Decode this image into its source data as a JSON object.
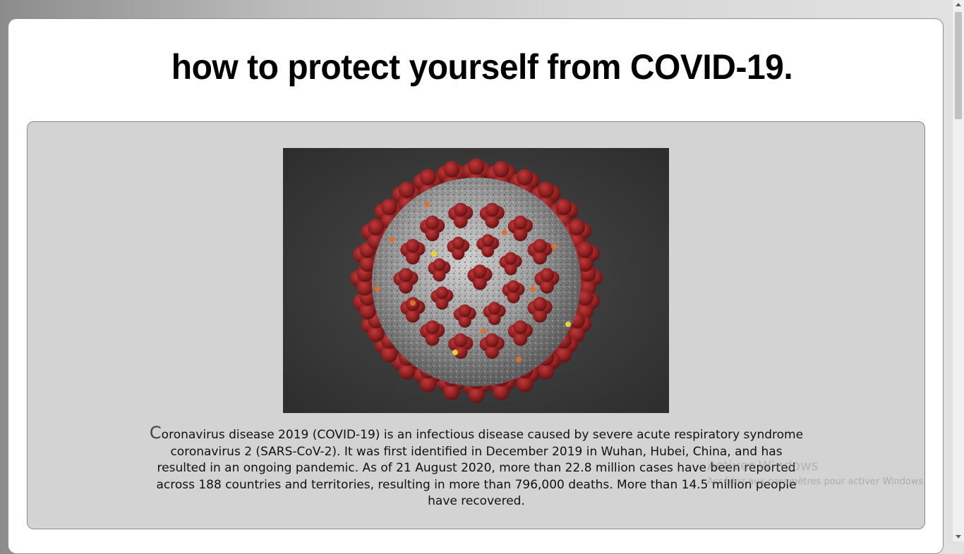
{
  "page": {
    "title": "how to protect yourself from COVID-19."
  },
  "image": {
    "subject": "coronavirus-illustration",
    "colors": {
      "background": "#383838",
      "core": "#a7a7a7",
      "spikes": "#8e1f20",
      "accent_orange": "#d9722e",
      "accent_yellow": "#e8d23a"
    }
  },
  "intro": {
    "first_letter": "C",
    "text": "oronavirus disease 2019 (COVID-19) is an infectious disease caused by severe acute respiratory syndrome coronavirus 2 (SARS-CoV-2). It was first identified in December 2019 in Wuhan, Hubei, China, and has resulted in an ongoing pandemic. As of 21 August 2020, more than 22.8 million cases have been reported across 188 countries and territories, resulting in more than 796,000 deaths. More than 14.5 million people have recovered."
  },
  "watermark": {
    "title": "Activer Windows",
    "subtitle": "Accédez aux paramètres pour activer Windows."
  },
  "colors": {
    "panel": "#d3d3d3",
    "card": "#ffffff"
  }
}
